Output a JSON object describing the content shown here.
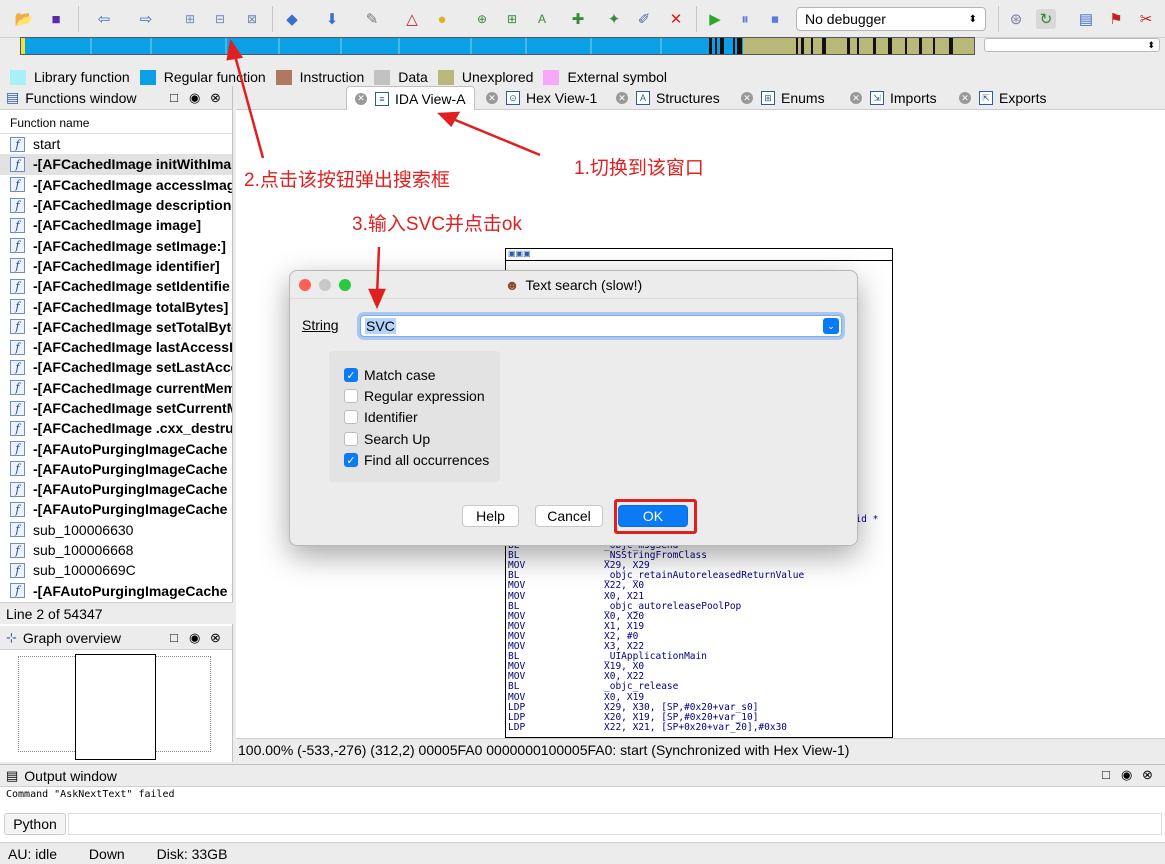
{
  "toolbar": {
    "debugger_value": "No debugger"
  },
  "legend": [
    {
      "label": "Library function",
      "color": "#a8f0f8"
    },
    {
      "label": "Regular function",
      "color": "#0b9fe6"
    },
    {
      "label": "Instruction",
      "color": "#b07860"
    },
    {
      "label": "Data",
      "color": "#c2c2c2"
    },
    {
      "label": "Unexplored",
      "color": "#b8b878"
    },
    {
      "label": "External symbol",
      "color": "#f8a8f8"
    }
  ],
  "functions_window": {
    "title": "Functions window",
    "column": "Function name",
    "items": [
      {
        "name": "start",
        "bold": false
      },
      {
        "name": "-[AFCachedImage initWithIma",
        "bold": true
      },
      {
        "name": "-[AFCachedImage accessImag",
        "bold": true
      },
      {
        "name": "-[AFCachedImage description",
        "bold": true
      },
      {
        "name": "-[AFCachedImage image]",
        "bold": true
      },
      {
        "name": "-[AFCachedImage setImage:]",
        "bold": true
      },
      {
        "name": "-[AFCachedImage identifier]",
        "bold": true
      },
      {
        "name": "-[AFCachedImage setIdentifie",
        "bold": true
      },
      {
        "name": "-[AFCachedImage totalBytes]",
        "bold": true
      },
      {
        "name": "-[AFCachedImage setTotalByte",
        "bold": true
      },
      {
        "name": "-[AFCachedImage lastAccessD",
        "bold": true
      },
      {
        "name": "-[AFCachedImage setLastAcce",
        "bold": true
      },
      {
        "name": "-[AFCachedImage currentMem",
        "bold": true
      },
      {
        "name": "-[AFCachedImage setCurrentM",
        "bold": true
      },
      {
        "name": "-[AFCachedImage .cxx_destru",
        "bold": true
      },
      {
        "name": "-[AFAutoPurgingImageCache i",
        "bold": true
      },
      {
        "name": "-[AFAutoPurgingImageCache i",
        "bold": true
      },
      {
        "name": "-[AFAutoPurgingImageCache c",
        "bold": true
      },
      {
        "name": "-[AFAutoPurgingImageCache r",
        "bold": true
      },
      {
        "name": "sub_100006630",
        "bold": false
      },
      {
        "name": "sub_100006668",
        "bold": false
      },
      {
        "name": "sub_10000669C",
        "bold": false
      },
      {
        "name": "-[AFAutoPurgingImageCache a",
        "bold": true
      }
    ],
    "status": "Line 2 of 54347"
  },
  "graph_overview": {
    "title": "Graph overview"
  },
  "tabs": [
    {
      "label": "IDA View-A",
      "active": true
    },
    {
      "label": "Hex View-1",
      "active": false
    },
    {
      "label": "Structures",
      "active": false
    },
    {
      "label": "Enums",
      "active": false
    },
    {
      "label": "Imports",
      "active": false
    },
    {
      "label": "Exports",
      "active": false
    }
  ],
  "code": {
    "partial": "void *",
    "lines": [
      {
        "op": "BL",
        "arg": "_objc_msgSend"
      },
      {
        "op": "BL",
        "arg": "_NSStringFromClass"
      },
      {
        "op": "MOV",
        "arg": "X29, X29"
      },
      {
        "op": "BL",
        "arg": "_objc_retainAutoreleasedReturnValue"
      },
      {
        "op": "MOV",
        "arg": "X22, X0"
      },
      {
        "op": "MOV",
        "arg": "X0, X21"
      },
      {
        "op": "BL",
        "arg": "_objc_autoreleasePoolPop"
      },
      {
        "op": "MOV",
        "arg": "X0, X20"
      },
      {
        "op": "MOV",
        "arg": "X1, X19"
      },
      {
        "op": "MOV",
        "arg": "X2, #0"
      },
      {
        "op": "MOV",
        "arg": "X3, X22"
      },
      {
        "op": "BL",
        "arg": "_UIApplicationMain"
      },
      {
        "op": "MOV",
        "arg": "X19, X0"
      },
      {
        "op": "MOV",
        "arg": "X0, X22"
      },
      {
        "op": "BL",
        "arg": "_objc_release"
      },
      {
        "op": "MOV",
        "arg": "X0, X19"
      },
      {
        "op": "LDP",
        "arg": "X29, X30, [SP,#0x20+var_s0]"
      },
      {
        "op": "LDP",
        "arg": "X20, X19, [SP,#0x20+var_10]"
      },
      {
        "op": "LDP",
        "arg": "X22, X21, [SP+0x20+var_20],#0x30"
      }
    ]
  },
  "main_status": "100.00% (-533,-276) (312,2) 00005FA0 0000000100005FA0: start (Synchronized with Hex View-1)",
  "output_window": {
    "title": "Output window",
    "text": "Command \"AskNextText\" failed",
    "python_label": "Python"
  },
  "statusbar": {
    "au": "AU:  idle",
    "direction": "Down",
    "disk": "Disk: 33GB"
  },
  "dialog": {
    "title": "Text search (slow!)",
    "string_label": "String",
    "string_value": "SVC",
    "options": [
      {
        "label": "Match case",
        "checked": true
      },
      {
        "label": "Regular expression",
        "checked": false
      },
      {
        "label": "Identifier",
        "checked": false
      },
      {
        "label": "Search Up",
        "checked": false
      },
      {
        "label": "Find all occurrences",
        "checked": true
      }
    ],
    "help_label": "Help",
    "cancel_label": "Cancel",
    "ok_label": "OK"
  },
  "annotations": {
    "step1": "1.切换到该窗口",
    "step2": "2.点击该按钮弹出搜索框",
    "step3": "3.输入SVC并点击ok",
    "color": "#e02020"
  }
}
